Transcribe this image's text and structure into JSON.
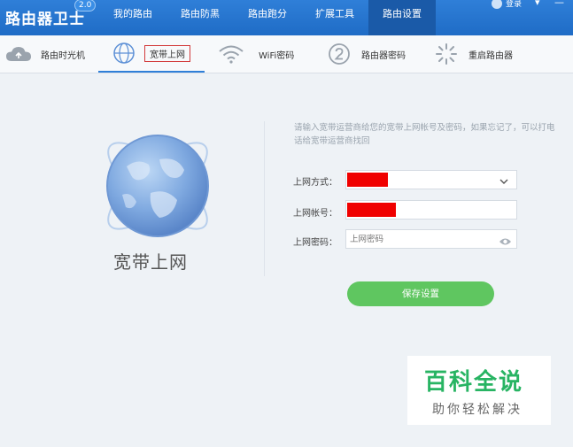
{
  "app": {
    "title": "路由器卫士",
    "version": "2.0",
    "login_label": "登录"
  },
  "nav": {
    "items": [
      {
        "label": "我的路由"
      },
      {
        "label": "路由防黑"
      },
      {
        "label": "路由跑分"
      },
      {
        "label": "扩展工具"
      },
      {
        "label": "路由设置"
      }
    ],
    "active_index": 4
  },
  "subtabs": {
    "items": [
      {
        "label": "路由时光机",
        "icon": "cloud-icon"
      },
      {
        "label": "宽带上网",
        "icon": "globe-icon"
      },
      {
        "label": "WiFi密码",
        "icon": "wifi-icon"
      },
      {
        "label": "路由器密码",
        "icon": "password-icon"
      },
      {
        "label": "重启路由器",
        "icon": "restart-icon"
      }
    ],
    "active_index": 1
  },
  "main": {
    "section_title": "宽带上网",
    "hint": "请输入宽带运营商给您的宽带上网帐号及密码，如果忘记了，可以打电话给宽带运营商找回",
    "form": {
      "method_label": "上网方式：",
      "account_label": "上网帐号：",
      "password_label": "上网密码：",
      "password_placeholder": "上网密码"
    },
    "save_label": "保存设置"
  },
  "watermark": {
    "title": "百科全说",
    "subtitle": "助你轻松解决"
  },
  "colors": {
    "topbar": "#1f6cc6",
    "active_nav": "#1a5aa8",
    "save_button": "#5fc660",
    "redaction": "#f00000",
    "watermark_green": "#28b463"
  }
}
